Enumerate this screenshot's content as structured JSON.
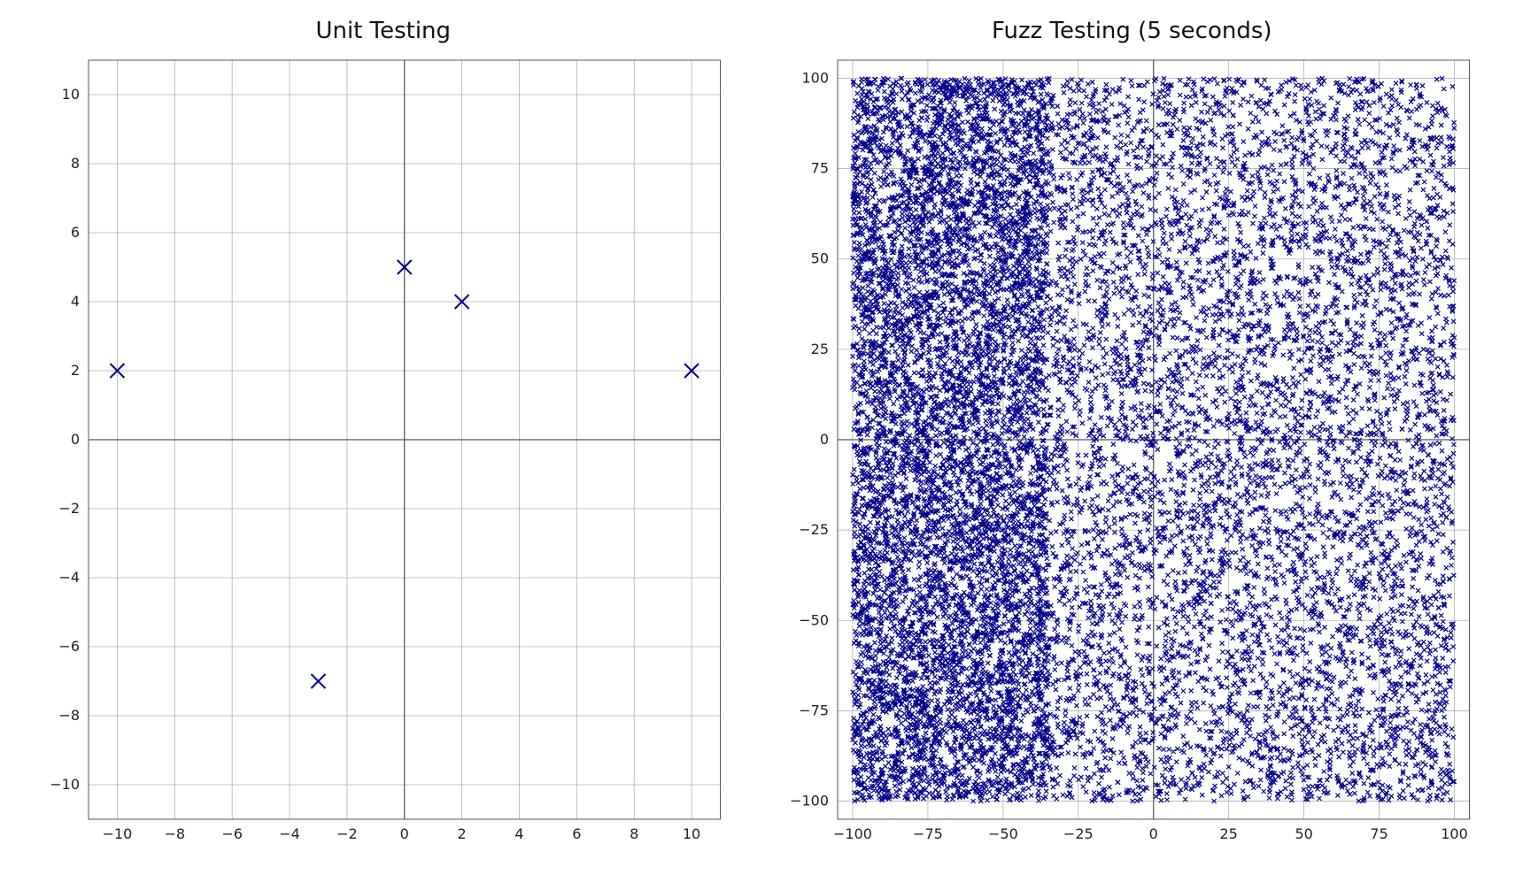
{
  "colors": {
    "marker": "#00008B",
    "grid": "#b0b0b0",
    "spine": "#555555",
    "text": "#222222"
  },
  "left": {
    "title": "Unit Testing",
    "xlim": [
      -11,
      11
    ],
    "ylim": [
      -11,
      11
    ],
    "xticks": [
      -10,
      -8,
      -6,
      -4,
      -2,
      0,
      2,
      4,
      6,
      8,
      10
    ],
    "yticks": [
      -10,
      -8,
      -6,
      -4,
      -2,
      0,
      2,
      4,
      6,
      8,
      10
    ],
    "points": [
      {
        "x": -10,
        "y": 2
      },
      {
        "x": -3,
        "y": -7
      },
      {
        "x": 0,
        "y": 5
      },
      {
        "x": 2,
        "y": 4
      },
      {
        "x": 10,
        "y": 2
      }
    ]
  },
  "right": {
    "title": "Fuzz Testing (5 seconds)",
    "xlim": [
      -105,
      105
    ],
    "ylim": [
      -105,
      105
    ],
    "xticks": [
      -100,
      -75,
      -50,
      -25,
      0,
      25,
      50,
      75,
      100
    ],
    "yticks": [
      -100,
      -75,
      -50,
      -25,
      0,
      25,
      50,
      75,
      100
    ],
    "density_note": "Dense random scatter filling [-100,100]² with heavier coverage at x < -35",
    "n_points_approx": 15000,
    "dense_x_threshold": -35,
    "seed": 987654321
  },
  "chart_data": [
    {
      "type": "scatter",
      "title": "Unit Testing",
      "x": [
        -10,
        -3,
        0,
        2,
        10
      ],
      "y": [
        2,
        -7,
        5,
        4,
        2
      ],
      "xlabel": "",
      "ylabel": "",
      "xlim": [
        -11,
        11
      ],
      "ylim": [
        -11,
        11
      ],
      "marker": "x",
      "marker_color": "#00008B",
      "grid": true,
      "show_origin_axes": true
    },
    {
      "type": "scatter",
      "title": "Fuzz Testing (5 seconds)",
      "note": "Approx 15000 pseudo-random points uniform in [-100,100] on each axis, visually denser in the left third (x < -35).",
      "n_points": 15000,
      "x_range": [
        -100,
        100
      ],
      "y_range": [
        -100,
        100
      ],
      "xlabel": "",
      "ylabel": "",
      "xlim": [
        -105,
        105
      ],
      "ylim": [
        -105,
        105
      ],
      "marker": "x",
      "marker_color": "#00008B",
      "grid": true,
      "show_origin_axes": true
    }
  ]
}
